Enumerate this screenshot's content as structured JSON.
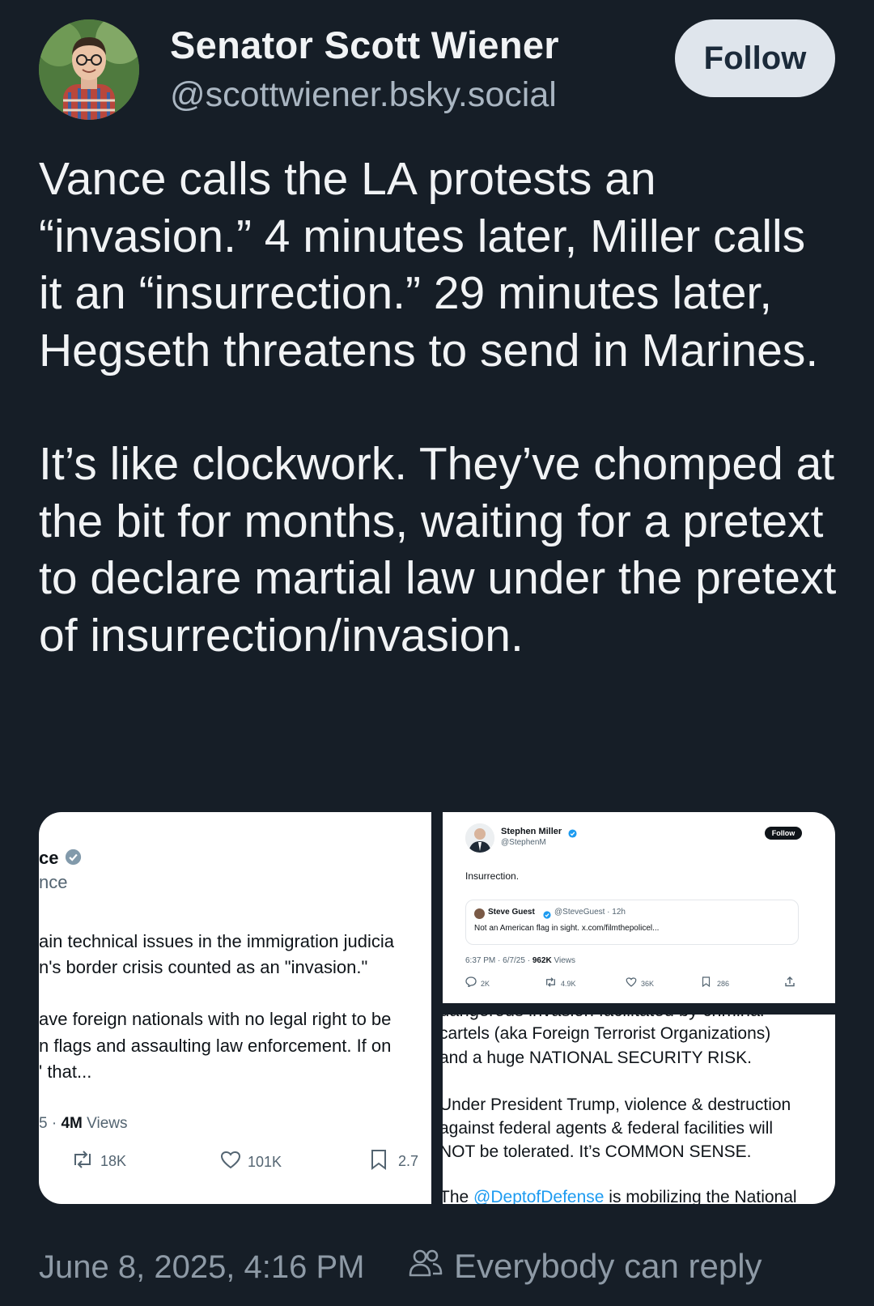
{
  "author": {
    "name": "Senator Scott Wiener",
    "handle": "@scottwiener.bsky.social",
    "follow_label": "Follow"
  },
  "post": {
    "paragraphs": [
      "Vance calls the LA protests an “invasion.” 4 minutes later, Miller calls it an “insurrection.” 29 minutes later, Hegseth threatens to send in Marines.",
      "It’s like clockwork. They’ve chomped at the bit for months, waiting for a pretext to declare martial law under the pretext of insurrection/invasion."
    ]
  },
  "embed_left": {
    "name_partial": "ce",
    "handle_partial": "nce",
    "lines": [
      "ain technical issues in the immigration judicia",
      "n's border crisis counted as an \"invasion.\"",
      "ave foreign nationals with no legal right to be",
      "n flags and assaulting law enforcement. If on",
      "' that..."
    ],
    "meta_prefix": "5 · ",
    "views_count": "4M",
    "views_label": "Views",
    "reposts": "18K",
    "likes": "101K",
    "bookmarks": "2.7"
  },
  "embed_miller": {
    "name": "Stephen Miller",
    "handle": "@StephenM",
    "follow_label": "Follow",
    "text": "Insurrection.",
    "quote": {
      "name": "Steve Guest",
      "handle_time": "@SteveGuest · 12h",
      "text": "Not an American flag in sight. x.com/filmthepolicel..."
    },
    "meta_prefix": "6:37 PM · 6/7/25 · ",
    "views_count": "962K",
    "views_label": "Views",
    "replies": "2K",
    "reposts": "4.9K",
    "likes": "36K",
    "bookmarks": "286"
  },
  "embed_hegseth": {
    "cut_line": "dangerous invasion facilitated by criminal",
    "lines1": [
      "cartels (aka Foreign Terrorist Organizations)",
      "and a huge NATIONAL SECURITY RISK."
    ],
    "lines2": [
      "Under President Trump, violence & destruction",
      "against federal agents & federal facilities will",
      "NOT be tolerated. It’s COMMON SENSE."
    ],
    "last_prefix": "The ",
    "last_mention": "@DeptofDefense",
    "last_suffix": " is mobilizing the National"
  },
  "footer": {
    "date": "June 8, 2025, 4:16 PM",
    "reply_setting": "Everybody can reply"
  },
  "colors": {
    "background": "#161e27",
    "link": "#1d9bf0",
    "verified": "#1d9bf0"
  }
}
